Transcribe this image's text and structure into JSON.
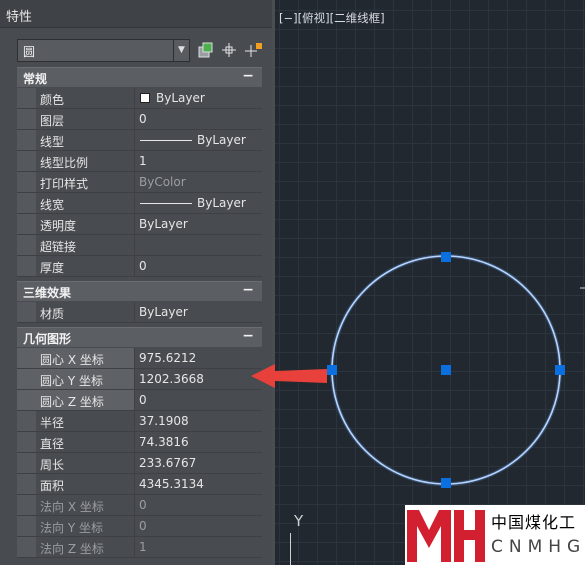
{
  "panel": {
    "title": "特性",
    "object_type": "圆",
    "tools": [
      "quick-select-icon",
      "pickadd-icon",
      "select-objects-icon"
    ]
  },
  "sections": {
    "general": {
      "title": "常规",
      "collapse": "−",
      "rows": [
        {
          "key": "颜色",
          "value": "ByLayer"
        },
        {
          "key": "图层",
          "value": "0"
        },
        {
          "key": "线型",
          "value": "ByLayer"
        },
        {
          "key": "线型比例",
          "value": "1"
        },
        {
          "key": "打印样式",
          "value": "ByColor"
        },
        {
          "key": "线宽",
          "value": "ByLayer"
        },
        {
          "key": "透明度",
          "value": "ByLayer"
        },
        {
          "key": "超链接",
          "value": ""
        },
        {
          "key": "厚度",
          "value": "0"
        }
      ]
    },
    "effects3d": {
      "title": "三维效果",
      "collapse": "−",
      "rows": [
        {
          "key": "材质",
          "value": "ByLayer"
        }
      ]
    },
    "geometry": {
      "title": "几何图形",
      "collapse": "−",
      "rows": [
        {
          "key": "圆心 X 坐标",
          "value": "975.6212"
        },
        {
          "key": "圆心 Y 坐标",
          "value": "1202.3668"
        },
        {
          "key": "圆心 Z 坐标",
          "value": "0"
        },
        {
          "key": "半径",
          "value": "37.1908"
        },
        {
          "key": "直径",
          "value": "74.3816"
        },
        {
          "key": "周长",
          "value": "233.6767"
        },
        {
          "key": "面积",
          "value": "4345.3134"
        },
        {
          "key": "法向 X 坐标",
          "value": "0"
        },
        {
          "key": "法向 Y 坐标",
          "value": "0"
        },
        {
          "key": "法向 Z 坐标",
          "value": "1"
        }
      ]
    }
  },
  "viewport": {
    "label": "[−][俯视][二维线框]",
    "ucs_axis": "Y"
  },
  "colors": {
    "circle": "#cfe4ff",
    "grip": "#0b6fe0",
    "arrow": "#e8403a",
    "logo_red": "#d32030"
  },
  "logo": {
    "name_cn": "中国煤化工",
    "name_en": "CNMHG"
  }
}
